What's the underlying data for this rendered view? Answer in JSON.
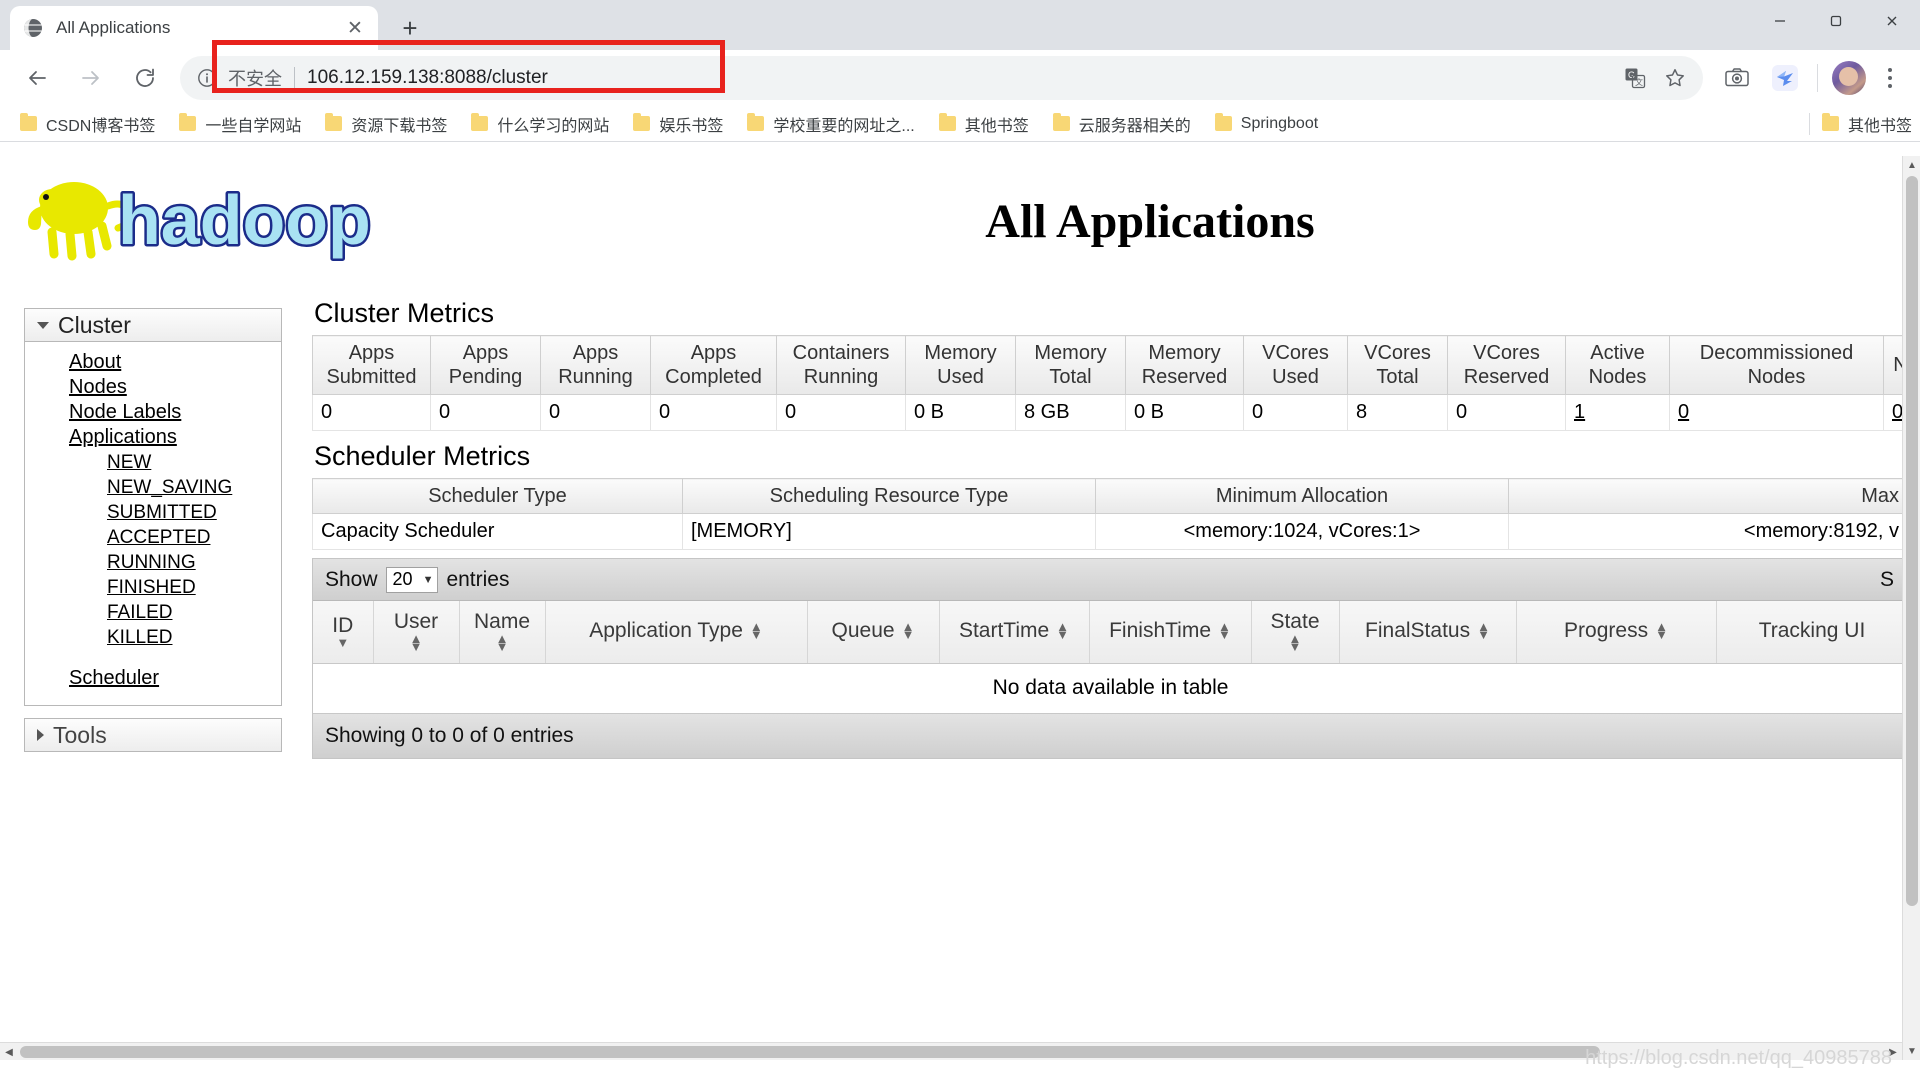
{
  "browser": {
    "tab": {
      "title": "All Applications",
      "favicon": "globe-icon",
      "close": "✕"
    },
    "newtab_label": "+",
    "window_controls": {
      "minimize": "─",
      "maximize": "❐",
      "close": "✕"
    },
    "nav": {
      "back": "←",
      "forward": "→",
      "reload": "↻"
    },
    "omnibox": {
      "info_icon": "info-circle-icon",
      "security_label": "不安全",
      "separator": "|",
      "url": "106.12.159.138:8088/cluster",
      "translate_icon": "translate-icon",
      "bookmark_star_icon": "star-icon"
    },
    "toolbar_icons": [
      "camera-icon",
      "bird-extension-icon"
    ],
    "profile": "avatar",
    "menu": "kebab-menu-icon",
    "bookmarks": [
      {
        "label": "CSDN博客书签"
      },
      {
        "label": "一些自学网站"
      },
      {
        "label": "资源下载书签"
      },
      {
        "label": "什么学习的网站"
      },
      {
        "label": "娱乐书签"
      },
      {
        "label": "学校重要的网址之..."
      },
      {
        "label": "其他书签"
      },
      {
        "label": "云服务器相关的"
      },
      {
        "label": "Springboot"
      }
    ],
    "bookmarks_overflow": {
      "label": "其他书签"
    }
  },
  "page": {
    "logo_text": "hadoop",
    "title": "All Applications",
    "watermark": "https://blog.csdn.net/qq_40985788",
    "sidebar": {
      "cluster": {
        "header": "Cluster",
        "links": [
          "About",
          "Nodes",
          "Node Labels",
          "Applications"
        ],
        "app_states": [
          "NEW",
          "NEW_SAVING",
          "SUBMITTED",
          "ACCEPTED",
          "RUNNING",
          "FINISHED",
          "FAILED",
          "KILLED"
        ],
        "scheduler_link": "Scheduler"
      },
      "tools": {
        "header": "Tools"
      }
    },
    "cluster_metrics": {
      "title": "Cluster Metrics",
      "headers": [
        "Apps\nSubmitted",
        "Apps\nPending",
        "Apps\nRunning",
        "Apps\nCompleted",
        "Containers\nRunning",
        "Memory\nUsed",
        "Memory\nTotal",
        "Memory\nReserved",
        "VCores\nUsed",
        "VCores\nTotal",
        "VCores\nReserved",
        "Active\nNodes",
        "Decommissioned\nNodes",
        "N"
      ],
      "values": [
        "0",
        "0",
        "0",
        "0",
        "0",
        "0 B",
        "8 GB",
        "0 B",
        "0",
        "8",
        "0",
        "1",
        "0",
        "0"
      ],
      "linked": [
        false,
        false,
        false,
        false,
        false,
        false,
        false,
        false,
        false,
        false,
        false,
        true,
        true,
        true
      ]
    },
    "scheduler_metrics": {
      "title": "Scheduler Metrics",
      "headers": [
        "Scheduler Type",
        "Scheduling Resource Type",
        "Minimum Allocation",
        "Max"
      ],
      "values": [
        "Capacity Scheduler",
        "[MEMORY]",
        "<memory:1024, vCores:1>",
        "<memory:8192, v"
      ]
    },
    "datatable": {
      "show_label": "Show",
      "page_size": "20",
      "entries_label": "entries",
      "search_label": "S",
      "columns": [
        {
          "label": "ID",
          "sort": "desc",
          "stacked": true
        },
        {
          "label": "User",
          "sort": "both",
          "stacked": true
        },
        {
          "label": "Name",
          "sort": "both",
          "stacked": true
        },
        {
          "label": "Application Type",
          "sort": "both",
          "stacked": false
        },
        {
          "label": "Queue",
          "sort": "both",
          "stacked": false
        },
        {
          "label": "StartTime",
          "sort": "both",
          "stacked": false
        },
        {
          "label": "FinishTime",
          "sort": "both",
          "stacked": false
        },
        {
          "label": "State",
          "sort": "both",
          "stacked": true
        },
        {
          "label": "FinalStatus",
          "sort": "both",
          "stacked": false
        },
        {
          "label": "Progress",
          "sort": "both",
          "stacked": false
        },
        {
          "label": "Tracking UI",
          "sort": "both",
          "stacked": false
        }
      ],
      "empty_message": "No data available in table",
      "footer": "Showing 0 to 0 of 0 entries"
    }
  }
}
